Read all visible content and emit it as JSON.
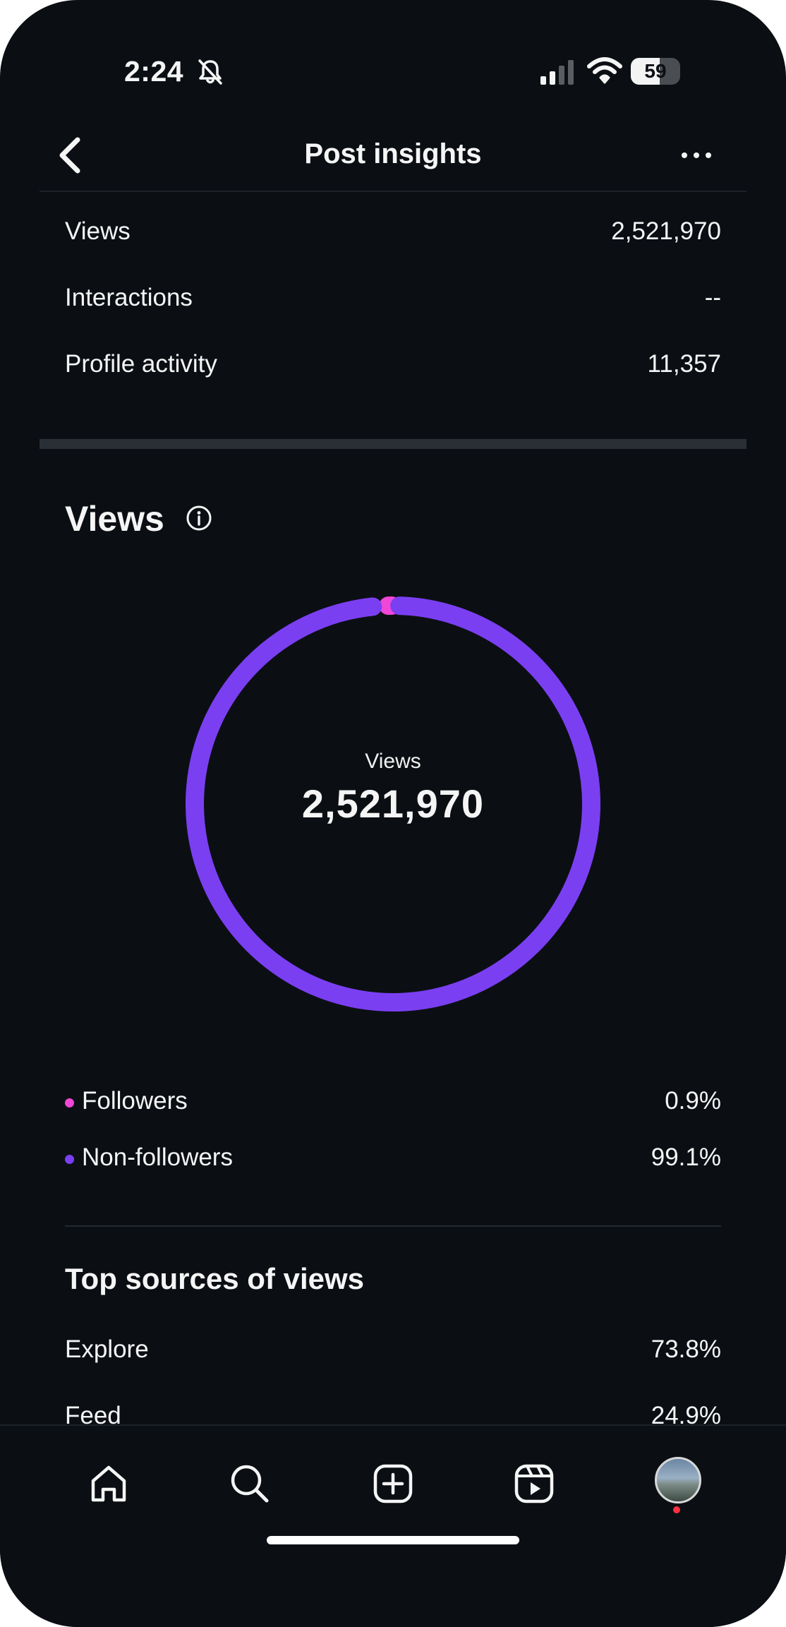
{
  "status_bar": {
    "time": "2:24",
    "battery": "59",
    "battery_level": 0.59
  },
  "header": {
    "title": "Post insights"
  },
  "metrics": [
    {
      "label": "Views",
      "value": "2,521,970"
    },
    {
      "label": "Interactions",
      "value": "--"
    },
    {
      "label": "Profile activity",
      "value": "11,357"
    }
  ],
  "views_section": {
    "title": "Views",
    "center_label": "Views",
    "center_value": "2,521,970",
    "legend": [
      {
        "label": "Followers",
        "value": "0.9%",
        "color": "#f047d6"
      },
      {
        "label": "Non-followers",
        "value": "99.1%",
        "color": "#7b3ff2"
      }
    ]
  },
  "chart_data": {
    "type": "pie",
    "style": "donut",
    "categories": [
      "Followers",
      "Non-followers"
    ],
    "values": [
      0.9,
      99.1
    ],
    "colors": [
      "#f047d6",
      "#7b3ff2"
    ]
  },
  "top_sources": {
    "title": "Top sources of views",
    "items": [
      {
        "label": "Explore",
        "value": "73.8%"
      },
      {
        "label": "Feed",
        "value": "24.9%"
      }
    ]
  },
  "tab_bar": {
    "items": [
      "home-icon",
      "search-icon",
      "create-icon",
      "reels-icon",
      "profile-avatar"
    ]
  }
}
